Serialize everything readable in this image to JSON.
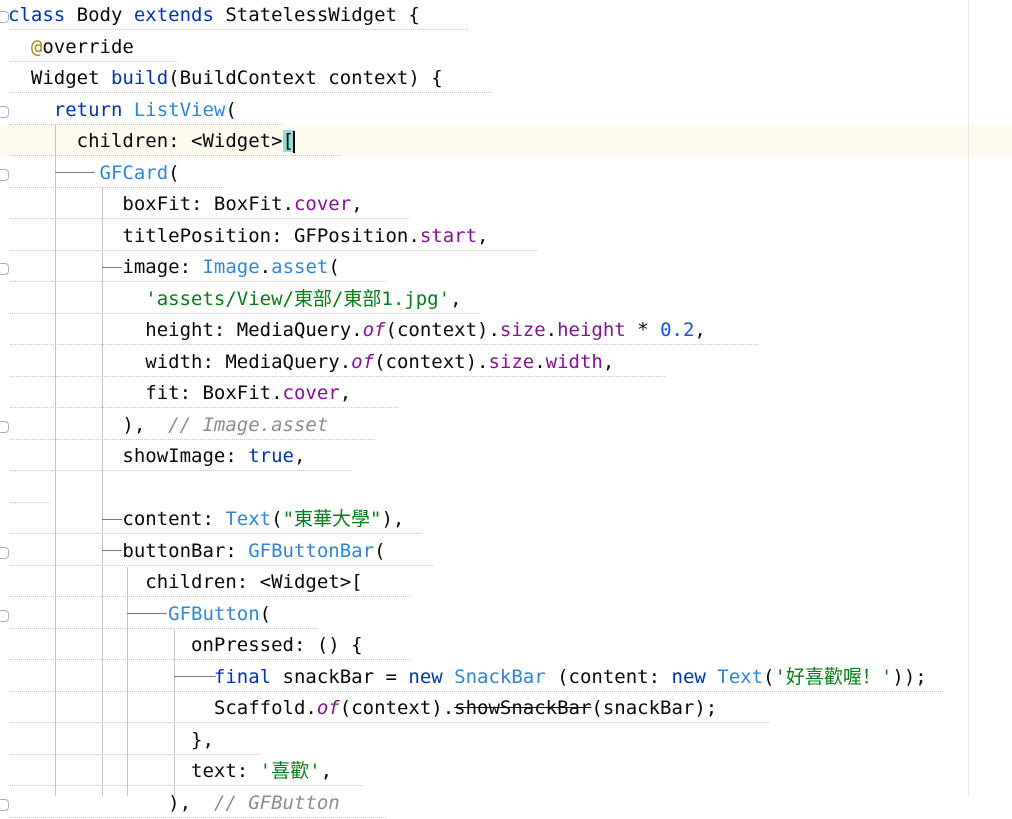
{
  "editor": {
    "lines": [
      [
        {
          "t": "class ",
          "c": "kw"
        },
        {
          "t": "Body ",
          "c": "plain"
        },
        {
          "t": "extends ",
          "c": "kw"
        },
        {
          "t": "StatelessWidget {",
          "c": "plain"
        }
      ],
      [
        {
          "t": "  ",
          "c": "plain"
        },
        {
          "t": "@",
          "c": "ann"
        },
        {
          "t": "override",
          "c": "plain"
        }
      ],
      [
        {
          "t": "  Widget ",
          "c": "plain"
        },
        {
          "t": "build",
          "c": "kw"
        },
        {
          "t": "(BuildContext context) {",
          "c": "plain"
        }
      ],
      [
        {
          "t": "    ",
          "c": "plain"
        },
        {
          "t": "return ",
          "c": "kw"
        },
        {
          "t": "ListView",
          "c": "cls"
        },
        {
          "t": "(",
          "c": "plain"
        }
      ],
      [
        {
          "t": "      children: <Widget>",
          "c": "plain"
        },
        {
          "t": "[",
          "c": "plain",
          "hl": true
        },
        {
          "t": "",
          "c": "caret"
        }
      ],
      [
        {
          "t": "        ",
          "c": "plain"
        },
        {
          "t": "GFCard",
          "c": "cls"
        },
        {
          "t": "(",
          "c": "plain"
        }
      ],
      [
        {
          "t": "          boxFit: BoxFit.",
          "c": "plain"
        },
        {
          "t": "cover",
          "c": "prop"
        },
        {
          "t": ",",
          "c": "plain"
        }
      ],
      [
        {
          "t": "          titlePosition: GFPosition.",
          "c": "plain"
        },
        {
          "t": "start",
          "c": "prop"
        },
        {
          "t": ",",
          "c": "plain"
        }
      ],
      [
        {
          "t": "          image: ",
          "c": "plain"
        },
        {
          "t": "Image",
          "c": "cls"
        },
        {
          "t": ".",
          "c": "plain"
        },
        {
          "t": "asset",
          "c": "cls"
        },
        {
          "t": "(",
          "c": "plain"
        }
      ],
      [
        {
          "t": "            ",
          "c": "plain"
        },
        {
          "t": "'assets/View/東部/東部1.jpg'",
          "c": "str"
        },
        {
          "t": ",",
          "c": "plain"
        }
      ],
      [
        {
          "t": "            height: MediaQuery.",
          "c": "plain"
        },
        {
          "t": "of",
          "c": "stat"
        },
        {
          "t": "(context).",
          "c": "plain"
        },
        {
          "t": "size",
          "c": "prop"
        },
        {
          "t": ".",
          "c": "plain"
        },
        {
          "t": "height",
          "c": "prop"
        },
        {
          "t": " * ",
          "c": "plain"
        },
        {
          "t": "0.2",
          "c": "num"
        },
        {
          "t": ",",
          "c": "plain"
        }
      ],
      [
        {
          "t": "            width: MediaQuery.",
          "c": "plain"
        },
        {
          "t": "of",
          "c": "stat"
        },
        {
          "t": "(context).",
          "c": "plain"
        },
        {
          "t": "size",
          "c": "prop"
        },
        {
          "t": ".",
          "c": "plain"
        },
        {
          "t": "width",
          "c": "prop"
        },
        {
          "t": ",",
          "c": "plain"
        }
      ],
      [
        {
          "t": "            fit: BoxFit.",
          "c": "plain"
        },
        {
          "t": "cover",
          "c": "prop"
        },
        {
          "t": ",",
          "c": "plain"
        }
      ],
      [
        {
          "t": "          ),  ",
          "c": "plain"
        },
        {
          "t": "// Image.asset",
          "c": "com"
        }
      ],
      [
        {
          "t": "          showImage: ",
          "c": "plain"
        },
        {
          "t": "true",
          "c": "kw"
        },
        {
          "t": ",",
          "c": "plain"
        }
      ],
      [
        {
          "t": "",
          "c": "plain"
        }
      ],
      [
        {
          "t": "          content: ",
          "c": "plain"
        },
        {
          "t": "Text",
          "c": "cls"
        },
        {
          "t": "(",
          "c": "plain"
        },
        {
          "t": "\"東華大學\"",
          "c": "str"
        },
        {
          "t": "),",
          "c": "plain"
        }
      ],
      [
        {
          "t": "          buttonBar: ",
          "c": "plain"
        },
        {
          "t": "GFButtonBar",
          "c": "cls"
        },
        {
          "t": "(",
          "c": "plain"
        }
      ],
      [
        {
          "t": "            children: <Widget>[",
          "c": "plain"
        }
      ],
      [
        {
          "t": "              ",
          "c": "plain"
        },
        {
          "t": "GFButton",
          "c": "cls"
        },
        {
          "t": "(",
          "c": "plain"
        }
      ],
      [
        {
          "t": "                onPressed: () {",
          "c": "plain"
        }
      ],
      [
        {
          "t": "                  ",
          "c": "plain"
        },
        {
          "t": "final ",
          "c": "kw"
        },
        {
          "t": "snackBar = ",
          "c": "plain"
        },
        {
          "t": "new ",
          "c": "kw"
        },
        {
          "t": "SnackBar ",
          "c": "cls"
        },
        {
          "t": "(content: ",
          "c": "plain"
        },
        {
          "t": "new ",
          "c": "kw"
        },
        {
          "t": "Text",
          "c": "cls"
        },
        {
          "t": "(",
          "c": "plain"
        },
        {
          "t": "'好喜歡喔！'",
          "c": "str"
        },
        {
          "t": "));",
          "c": "plain"
        }
      ],
      [
        {
          "t": "                  Scaffold.",
          "c": "plain"
        },
        {
          "t": "of",
          "c": "stat"
        },
        {
          "t": "(context).",
          "c": "plain"
        },
        {
          "t": "showSnackBar",
          "c": "deprecated"
        },
        {
          "t": "(snackBar);",
          "c": "plain"
        }
      ],
      [
        {
          "t": "                },",
          "c": "plain"
        }
      ],
      [
        {
          "t": "                text: ",
          "c": "plain"
        },
        {
          "t": "'喜歡'",
          "c": "str"
        },
        {
          "t": ",",
          "c": "plain"
        }
      ],
      [
        {
          "t": "              ),  ",
          "c": "plain"
        },
        {
          "t": "// GFButton",
          "c": "com"
        }
      ]
    ]
  }
}
